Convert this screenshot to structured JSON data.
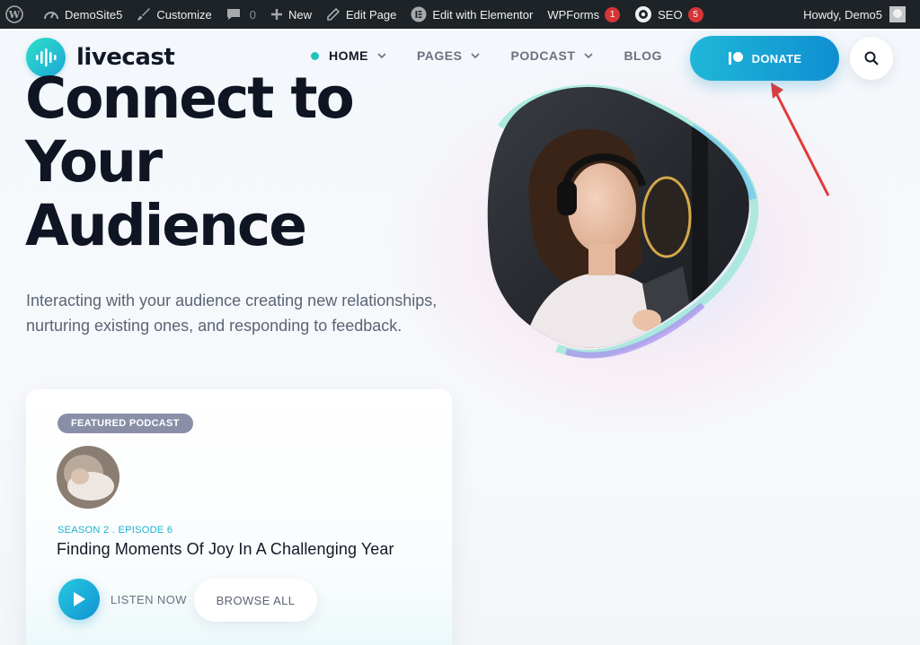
{
  "adminbar": {
    "site_name": "DemoSite5",
    "customize": "Customize",
    "comments_count": "0",
    "new": "New",
    "edit_page": "Edit Page",
    "edit_elementor": "Edit with Elementor",
    "wpforms": "WPForms",
    "wpforms_count": "1",
    "seo": "SEO",
    "seo_count": "5",
    "greeting": "Howdy, Demo5"
  },
  "header": {
    "logo_text": "livecast",
    "nav": [
      {
        "label": "HOME",
        "active": true,
        "dropdown": true
      },
      {
        "label": "PAGES",
        "active": false,
        "dropdown": true
      },
      {
        "label": "PODCAST",
        "active": false,
        "dropdown": true
      },
      {
        "label": "BLOG",
        "active": false,
        "dropdown": false
      }
    ],
    "donate_label": "DONATE"
  },
  "hero": {
    "title_lines": [
      "Connect to",
      "Your",
      "Audience"
    ],
    "description": "Interacting with your audience creating new relationships, nurturing existing ones, and responding to feedback."
  },
  "featured": {
    "badge": "FEATURED PODCAST",
    "season": "SEASON 2 . EPISODE 6",
    "title": "Finding Moments Of Joy In A Challenging Year",
    "listen_label": "LISTEN NOW",
    "browse_label": "BROWSE ALL"
  },
  "colors": {
    "accent": "#1aa7d8",
    "teal": "#22c4bd",
    "adminbar": "#1d2327",
    "badge_red": "#d63638"
  }
}
